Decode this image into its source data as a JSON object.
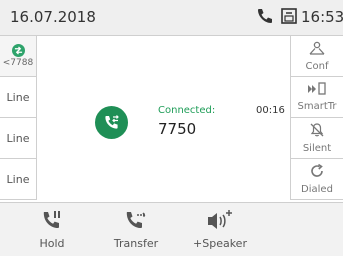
{
  "status_bar": {
    "date": "16.07.2018",
    "time": "16:53",
    "icons": [
      "phone-icon",
      "voicemail-icon"
    ]
  },
  "left_keys": [
    {
      "icon": "line-call-icon",
      "label": "<7788",
      "color": "#2ea36b"
    },
    {
      "label": "Line"
    },
    {
      "label": "Line"
    },
    {
      "label": "Line"
    }
  ],
  "right_keys": [
    {
      "icon": "conference-icon",
      "label": "Conf"
    },
    {
      "icon": "smart-transfer-icon",
      "label": "SmartTr"
    },
    {
      "icon": "bell-silent-icon",
      "label": "Silent"
    },
    {
      "icon": "refresh-icon",
      "label": "Dialed"
    }
  ],
  "call": {
    "state": "Connected:",
    "timer": "00:16",
    "number": "7750",
    "accent_color": "#1f8f56"
  },
  "bottom_keys": [
    {
      "icon": "hold-icon",
      "label": "Hold"
    },
    {
      "icon": "transfer-icon",
      "label": "Transfer"
    },
    {
      "icon": "speaker-icon",
      "label": "+Speaker"
    }
  ]
}
